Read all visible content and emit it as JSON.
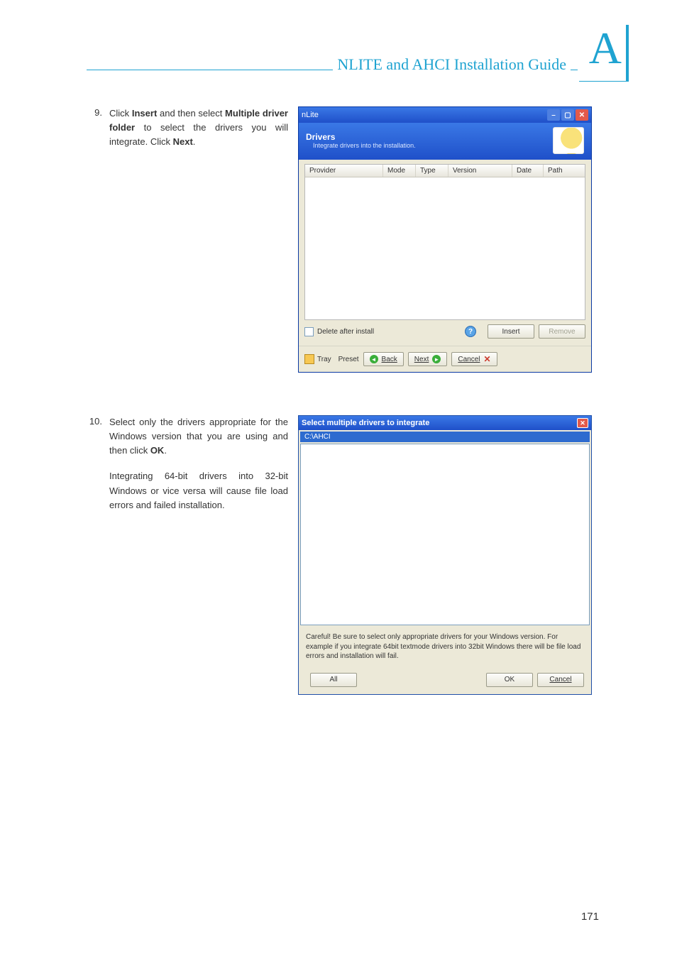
{
  "header": {
    "title": "NLITE and AHCI Installation Guide",
    "badge_letter": "A"
  },
  "page_number": "171",
  "steps": [
    {
      "num": "9.",
      "text_parts": [
        "Click ",
        "Insert",
        " and then select ",
        "Multiple driver folder",
        " to select the drivers you will integrate. Click ",
        "Next",
        "."
      ]
    },
    {
      "num": "10.",
      "text_parts_a": [
        "Select only the drivers appropriate for the Windows version that you are using and then click ",
        "OK",
        "."
      ],
      "text_parts_b": "Integrating 64-bit drivers into 32-bit Windows or vice versa will cause file load errors and failed installation."
    }
  ],
  "nlite_window": {
    "titlebar": "nLite",
    "drivers_title": "Drivers",
    "drivers_subtitle": "Integrate drivers into the installation.",
    "columns": {
      "provider": "Provider",
      "mode": "Mode",
      "type": "Type",
      "version": "Version",
      "date": "Date",
      "path": "Path"
    },
    "delete_after": "Delete after install",
    "insert_btn": "Insert",
    "remove_btn": "Remove",
    "tray": "Tray",
    "preset": "Preset",
    "back": "Back",
    "next": "Next",
    "cancel": "Cancel"
  },
  "dialog": {
    "title": "Select multiple drivers to integrate",
    "path": "C:\\AHCI",
    "warning": "Careful! Be sure to select only appropriate drivers for your Windows version. For example if you integrate 64bit textmode drivers into 32bit Windows there will be file load errors and installation will fail.",
    "all_btn": "All",
    "ok_btn": "OK",
    "cancel_btn": "Cancel"
  }
}
